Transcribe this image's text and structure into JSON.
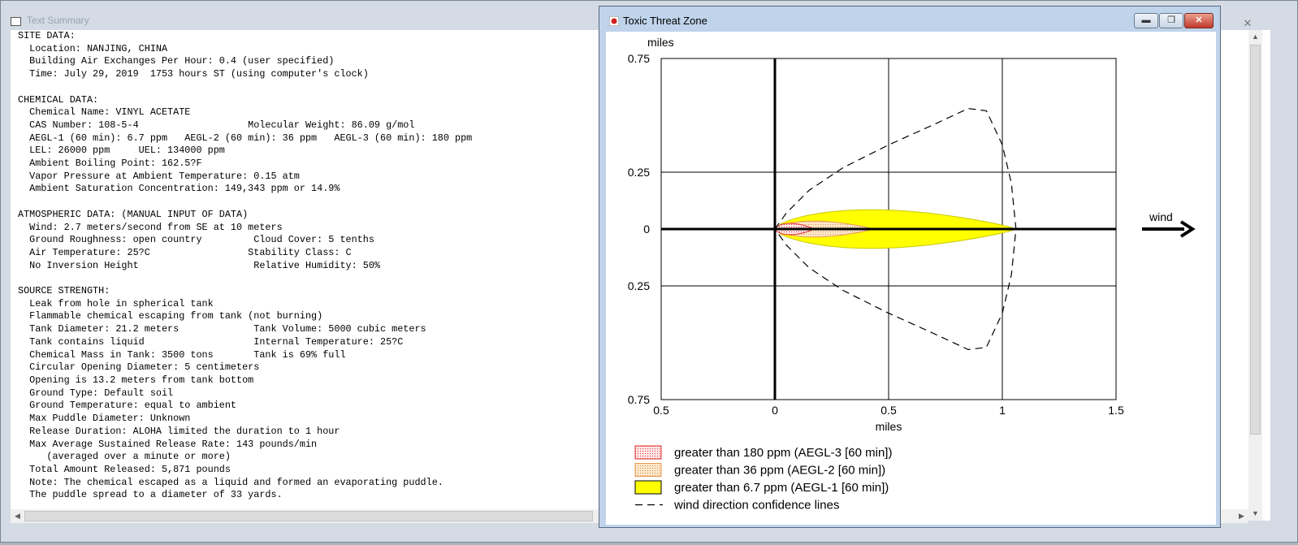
{
  "text_summary": {
    "title": "Text Summary",
    "lines": [
      "SITE DATA:",
      "  Location: NANJING, CHINA",
      "  Building Air Exchanges Per Hour: 0.4 (user specified)",
      "  Time: July 29, 2019  1753 hours ST (using computer's clock)",
      "",
      "CHEMICAL DATA:",
      "  Chemical Name: VINYL ACETATE",
      "  CAS Number: 108-5-4                   Molecular Weight: 86.09 g/mol",
      "  AEGL-1 (60 min): 6.7 ppm   AEGL-2 (60 min): 36 ppm   AEGL-3 (60 min): 180 ppm",
      "  LEL: 26000 ppm     UEL: 134000 ppm",
      "  Ambient Boiling Point: 162.5?F",
      "  Vapor Pressure at Ambient Temperature: 0.15 atm",
      "  Ambient Saturation Concentration: 149,343 ppm or 14.9%",
      "",
      "ATMOSPHERIC DATA: (MANUAL INPUT OF DATA)",
      "  Wind: 2.7 meters/second from SE at 10 meters",
      "  Ground Roughness: open country         Cloud Cover: 5 tenths",
      "  Air Temperature: 25?C                 Stability Class: C",
      "  No Inversion Height                    Relative Humidity: 50%",
      "",
      "SOURCE STRENGTH:",
      "  Leak from hole in spherical tank",
      "  Flammable chemical escaping from tank (not burning)",
      "  Tank Diameter: 21.2 meters             Tank Volume: 5000 cubic meters",
      "  Tank contains liquid                   Internal Temperature: 25?C",
      "  Chemical Mass in Tank: 3500 tons       Tank is 69% full",
      "  Circular Opening Diameter: 5 centimeters",
      "  Opening is 13.2 meters from tank bottom",
      "  Ground Type: Default soil",
      "  Ground Temperature: equal to ambient",
      "  Max Puddle Diameter: Unknown",
      "  Release Duration: ALOHA limited the duration to 1 hour",
      "  Max Average Sustained Release Rate: 143 pounds/min",
      "     (averaged over a minute or more)",
      "  Total Amount Released: 5,871 pounds",
      "  Note: The chemical escaped as a liquid and formed an evaporating puddle.",
      "  The puddle spread to a diameter of 33 yards."
    ],
    "close_glyph": "✕"
  },
  "threat_zone": {
    "title": "Toxic Threat Zone",
    "buttons": {
      "minimize": "▬",
      "maximize": "❐",
      "close": "✕"
    },
    "colors": {
      "aegl3": "#e03030",
      "aegl2": "#f0b060",
      "aegl1": "#ffff00",
      "confidence": "#000000"
    }
  },
  "chart_data": {
    "type": "area",
    "title": "",
    "xlabel": "miles",
    "ylabel": "miles",
    "xlim": [
      -0.5,
      1.5
    ],
    "ylim": [
      -0.75,
      0.75
    ],
    "x_ticks": [
      -0.5,
      0,
      0.5,
      1,
      1.5
    ],
    "x_tick_labels": [
      "0.5",
      "0",
      "0.5",
      "1",
      "1.5"
    ],
    "y_ticks": [
      0.75,
      0.25,
      0,
      -0.25,
      -0.75
    ],
    "y_tick_labels": [
      "0.75",
      "0.25",
      "0",
      "0.25",
      "0.75"
    ],
    "grid": true,
    "wind_label": "wind",
    "series": [
      {
        "name": "greater than 6.7 ppm (AEGL-1 [60 min])",
        "shape": "plume",
        "x_start": 0,
        "x_end": 1.06,
        "max_half_width": 0.085,
        "color": "#ffff00",
        "fill": "solid"
      },
      {
        "name": "greater than 36 ppm (AEGL-2 [60 min])",
        "shape": "plume",
        "x_start": 0,
        "x_end": 0.43,
        "max_half_width": 0.035,
        "color": "#f0b060",
        "fill": "dotted"
      },
      {
        "name": "greater than 180 ppm (AEGL-3 [60 min])",
        "shape": "plume",
        "x_start": 0,
        "x_end": 0.17,
        "max_half_width": 0.025,
        "color": "#e03030",
        "fill": "dotted"
      },
      {
        "name": "wind direction confidence lines",
        "shape": "dashed",
        "points": [
          [
            0,
            0
          ],
          [
            0.05,
            0.07
          ],
          [
            0.15,
            0.17
          ],
          [
            0.3,
            0.27
          ],
          [
            0.5,
            0.37
          ],
          [
            0.7,
            0.46
          ],
          [
            0.85,
            0.53
          ],
          [
            0.93,
            0.52
          ],
          [
            1.0,
            0.37
          ],
          [
            1.04,
            0.2
          ],
          [
            1.06,
            0
          ],
          [
            1.04,
            -0.2
          ],
          [
            1.0,
            -0.37
          ],
          [
            0.93,
            -0.52
          ],
          [
            0.85,
            -0.53
          ],
          [
            0.7,
            -0.46
          ],
          [
            0.5,
            -0.37
          ],
          [
            0.3,
            -0.27
          ],
          [
            0.15,
            -0.17
          ],
          [
            0.05,
            -0.07
          ],
          [
            0,
            0
          ]
        ],
        "color": "#000000"
      }
    ],
    "legend": [
      "greater than 180 ppm (AEGL-3 [60 min])",
      "greater than 36 ppm (AEGL-2 [60 min])",
      "greater than 6.7 ppm (AEGL-1 [60 min])",
      "wind direction confidence lines"
    ]
  }
}
